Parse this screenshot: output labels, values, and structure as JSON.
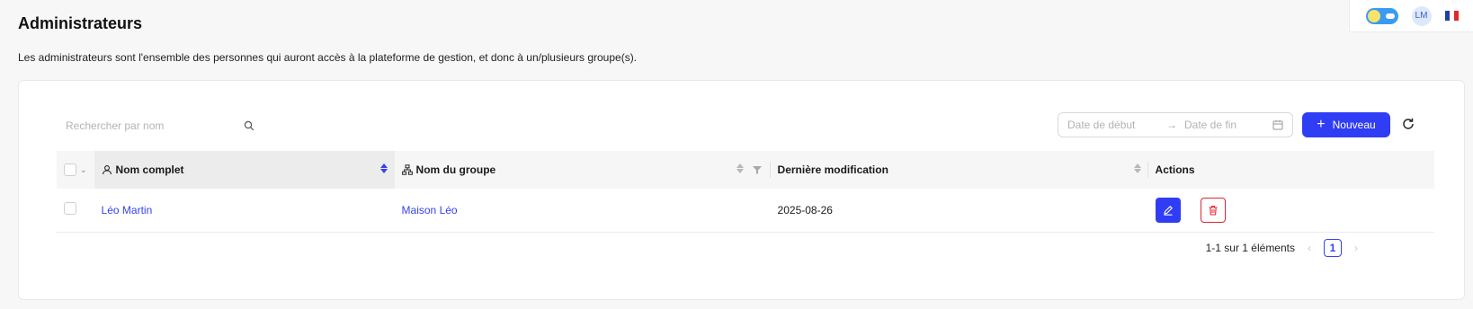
{
  "header": {
    "title": "Administrateurs",
    "description": "Les administrateurs sont l'ensemble des personnes qui auront accès à la plateforme de gestion, et donc à un/plusieurs groupe(s).",
    "user_initials": "LM",
    "theme_toggle": "day-theme-toggle",
    "language_flag": "flag-france-icon"
  },
  "toolbar": {
    "search_placeholder": "Rechercher par nom",
    "date_start_placeholder": "Date de début",
    "date_end_placeholder": "Date de fin",
    "range_arrow": "→",
    "new_label": "Nouveau"
  },
  "table": {
    "columns": [
      "Nom complet",
      "Nom du groupe",
      "Dernière modification",
      "Actions"
    ],
    "rows": [
      {
        "name": "Léo Martin",
        "group": "Maison Léo",
        "modified": "2025-08-26"
      }
    ]
  },
  "pagination": {
    "summary": "1-1 sur 1 éléments",
    "current_page": "1",
    "prev": "‹",
    "next": "›"
  },
  "colors": {
    "primary": "#2f3df5",
    "danger": "#e0262f",
    "link": "#3343f0"
  }
}
